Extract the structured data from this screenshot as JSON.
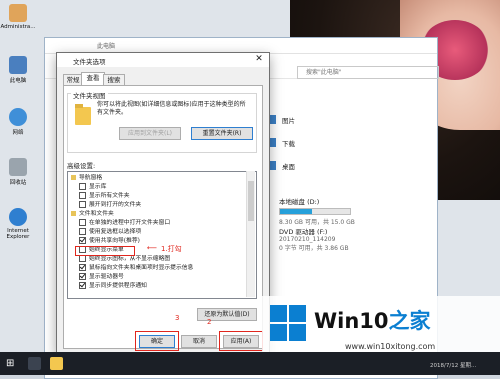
{
  "desktop": {
    "icons": [
      {
        "label": "Administra...",
        "color": "#e0a45a"
      },
      {
        "label": "此电脑",
        "color": "#4a7fbf"
      },
      {
        "label": "网络",
        "color": "#3f8fd8"
      },
      {
        "label": "回收站",
        "color": "#9aa4ad"
      },
      {
        "label": "Internet Explorer",
        "color": "#2f7fd0"
      }
    ]
  },
  "explorer": {
    "title": "此电脑",
    "search_placeholder": "搜索\"此电脑\"",
    "nav": [
      {
        "label": "图片"
      },
      {
        "label": "下载"
      },
      {
        "label": "桌面"
      }
    ],
    "drives": [
      {
        "name": "本地磁盘 (D:)",
        "detail": "8.30 GB 可用，共 15.0 GB",
        "fill": 0.45
      },
      {
        "name": "DVD 驱动器 (F:)",
        "detail": "20170210_114209",
        "extra": "0 字节 可用，共 3.86 GB"
      }
    ]
  },
  "dialog": {
    "title": "文件夹选项",
    "close": "✕",
    "tabs": [
      "常规",
      "查看",
      "搜索"
    ],
    "active_tab": 1,
    "folder_view": {
      "group_label": "文件夹视图",
      "description": "你可以将此视图(如详细信息或图标)应用于这种类型的所有文件夹。",
      "apply_button": "应用到文件夹(L)",
      "reset_button": "重置文件夹(R)"
    },
    "advanced_label": "高级设置:",
    "settings": [
      {
        "label": "导航窗格",
        "kind": "group"
      },
      {
        "label": "显示库",
        "kind": "check",
        "checked": false
      },
      {
        "label": "显示所有文件夹",
        "kind": "check",
        "checked": false
      },
      {
        "label": "展开到打开的文件夹",
        "kind": "check",
        "checked": false
      },
      {
        "label": "文件和文件夹",
        "kind": "group"
      },
      {
        "label": "在单独的进程中打开文件夹窗口",
        "kind": "check",
        "checked": false
      },
      {
        "label": "使用复选框以选择项",
        "kind": "check",
        "checked": false
      },
      {
        "label": "使用共享向导(推荐)",
        "kind": "check",
        "checked": true
      },
      {
        "label": "始终显示菜单",
        "kind": "check",
        "checked": false
      },
      {
        "label": "始终显示图标，从不显示缩略图",
        "kind": "check",
        "checked": false
      },
      {
        "label": "鼠标指向文件夹和桌面项时显示提示信息",
        "kind": "check",
        "checked": true
      },
      {
        "label": "显示驱动器号",
        "kind": "check",
        "checked": true
      },
      {
        "label": "显示同步提供程序通知",
        "kind": "check",
        "checked": true
      }
    ],
    "restore_button": "还原为默认值(D)",
    "ok_button": "确定",
    "cancel_button": "取消",
    "apply_button": "应用(A)"
  },
  "annotations": {
    "step1": "1.打勾",
    "step2": "2",
    "step3": "3",
    "color": "#e0261d"
  },
  "taskbar": {
    "start_glyph": "⊞",
    "clock": "2018/7/12 星期..."
  },
  "watermark": {
    "title_main": "Win10",
    "title_accent": "之家",
    "url": "www.win10xitong.com",
    "logo_color": "#0b7fd1"
  }
}
